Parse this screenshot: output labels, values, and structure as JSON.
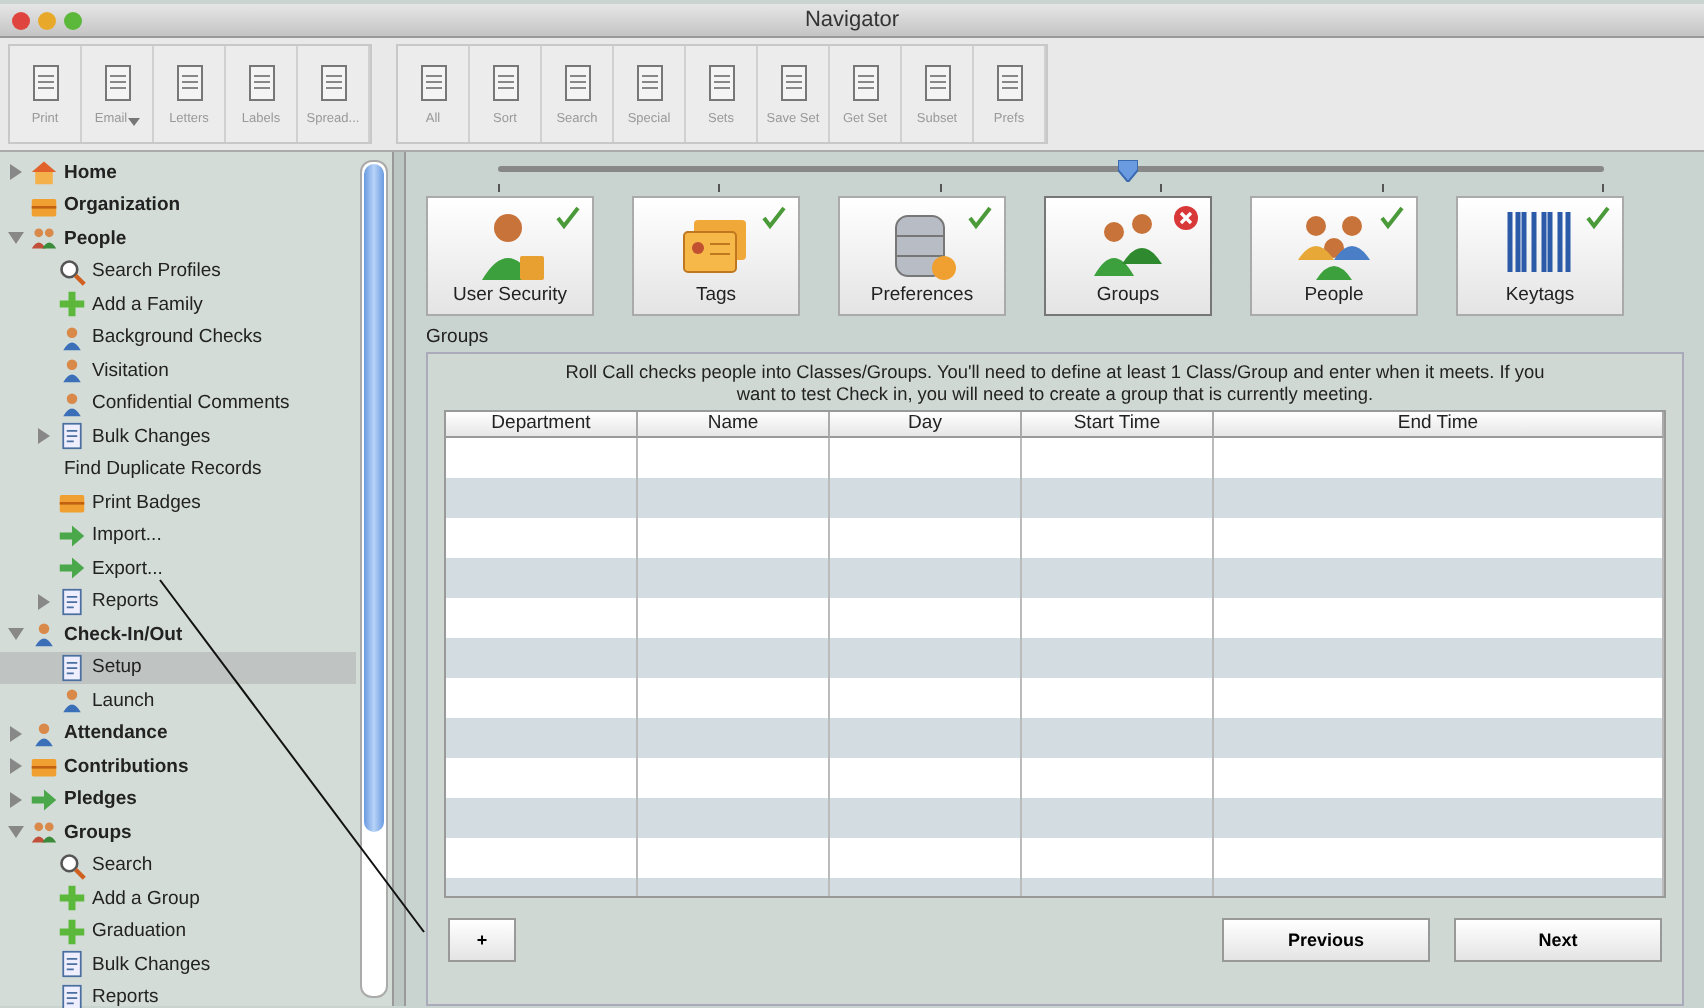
{
  "window": {
    "title": "Navigator"
  },
  "toolbar": {
    "groups": [
      [
        {
          "label": "Print"
        },
        {
          "label": "Email",
          "dropdown": true
        },
        {
          "label": "Letters"
        },
        {
          "label": "Labels"
        },
        {
          "label": "Spread..."
        }
      ],
      [
        {
          "label": "All"
        },
        {
          "label": "Sort"
        },
        {
          "label": "Search"
        },
        {
          "label": "Special"
        },
        {
          "label": "Sets"
        },
        {
          "label": "Save Set"
        },
        {
          "label": "Get Set"
        },
        {
          "label": "Subset"
        },
        {
          "label": "Prefs"
        }
      ]
    ]
  },
  "sidebar": {
    "items": [
      {
        "label": "Home",
        "kind": "house",
        "expanded": false,
        "selected": false
      },
      {
        "label": "Organization",
        "kind": "case",
        "selected": false
      },
      {
        "label": "People",
        "kind": "people",
        "expanded": true,
        "selected": false,
        "children": [
          {
            "label": "Search Profiles",
            "kind": "search",
            "selected": false
          },
          {
            "label": "Add a Family",
            "kind": "plus",
            "selected": false
          },
          {
            "label": "Background Checks",
            "kind": "person",
            "selected": false
          },
          {
            "label": "Visitation",
            "kind": "person",
            "selected": false
          },
          {
            "label": "Confidential Comments",
            "kind": "person",
            "selected": false
          },
          {
            "label": "Bulk Changes",
            "kind": "doc",
            "expanded": false,
            "selected": false
          },
          {
            "label": "Find Duplicate Records",
            "kind": "plain",
            "selected": false
          },
          {
            "label": "Print Badges",
            "kind": "case",
            "selected": false
          },
          {
            "label": "Import...",
            "kind": "arrow",
            "selected": false
          },
          {
            "label": "Export...",
            "kind": "arrow",
            "selected": false
          },
          {
            "label": "Reports",
            "kind": "doc",
            "expanded": false,
            "selected": false
          }
        ]
      },
      {
        "label": "Check-In/Out",
        "kind": "person",
        "expanded": true,
        "selected": false,
        "children": [
          {
            "label": "Setup",
            "kind": "doc",
            "selected": true
          },
          {
            "label": "Launch",
            "kind": "person",
            "selected": false
          }
        ]
      },
      {
        "label": "Attendance",
        "kind": "person",
        "expanded": false,
        "selected": false
      },
      {
        "label": "Contributions",
        "kind": "case",
        "expanded": false,
        "selected": false
      },
      {
        "label": "Pledges",
        "kind": "arrow",
        "expanded": false,
        "selected": false
      },
      {
        "label": "Groups",
        "kind": "people",
        "expanded": true,
        "selected": false,
        "children": [
          {
            "label": "Search",
            "kind": "search",
            "selected": false
          },
          {
            "label": "Add a Group",
            "kind": "plus",
            "selected": false
          },
          {
            "label": "Graduation",
            "kind": "plus",
            "selected": false
          },
          {
            "label": "Bulk Changes",
            "kind": "doc",
            "selected": false
          },
          {
            "label": "Reports",
            "kind": "doc",
            "selected": false
          }
        ]
      }
    ]
  },
  "wizard": {
    "level": 0.57,
    "steps": [
      {
        "label": "User Security",
        "kind": "security",
        "complete": true,
        "selected": false
      },
      {
        "label": "Tags",
        "kind": "tags",
        "complete": true,
        "selected": false
      },
      {
        "label": "Preferences",
        "kind": "database",
        "complete": true,
        "selected": false
      },
      {
        "label": "Groups",
        "kind": "group",
        "complete": false,
        "selected": true
      },
      {
        "label": "People",
        "kind": "people",
        "complete": true,
        "selected": false
      },
      {
        "label": "Keytags",
        "kind": "barcode",
        "complete": true,
        "selected": false
      }
    ]
  },
  "groups_panel": {
    "title": "Groups",
    "instructions": "Roll Call checks people into Classes/Groups.  You'll need to define at least 1 Class/Group and enter when it meets.  If you want to test Check in, you will need to create a group that is currently meeting.",
    "table": {
      "columns": [
        "Department",
        "Name",
        "Day",
        "Start Time",
        "End Time"
      ]
    }
  },
  "buttons": {
    "add": "+",
    "previous": "Previous",
    "next": "Next"
  }
}
